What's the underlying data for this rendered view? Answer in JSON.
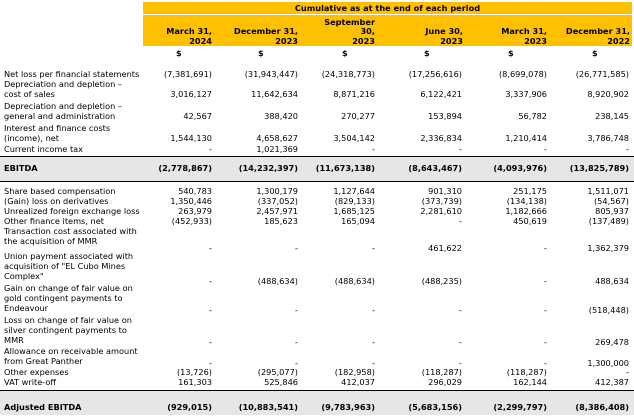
{
  "header": {
    "title": "Cumulative as at the end of each period"
  },
  "columns": [
    {
      "label": "March 31,\n2024",
      "currency": "$"
    },
    {
      "label": "December 31,\n2023",
      "currency": "$"
    },
    {
      "label": "September\n30,\n2023",
      "currency": "$"
    },
    {
      "label": "June 30,\n2023",
      "currency": "$"
    },
    {
      "label": "March 31,\n2023",
      "currency": "$"
    },
    {
      "label": "December 31,\n2022",
      "currency": "$"
    }
  ],
  "section1": [
    {
      "label": "Net loss per financial statements",
      "values": [
        "(7,381,691)",
        "(31,943,447)",
        "(24,318,773)",
        "(17,256,616)",
        "(8,699,078)",
        "(26,771,585)"
      ]
    },
    {
      "label": "Depreciation and depletion –\ncost of sales",
      "values": [
        "3,016,127",
        "11,642,634",
        "8,871,216",
        "6,122,421",
        "3,337,906",
        "8,920,902"
      ]
    },
    {
      "label": "Depreciation and depletion –\ngeneral and administration",
      "values": [
        "42,567",
        "388,420",
        "270,277",
        "153,894",
        "56,782",
        "238,145"
      ]
    },
    {
      "label": "Interest and finance costs\n(income), net",
      "values": [
        "1,544,130",
        "4,658,627",
        "3,504,142",
        "2,336,834",
        "1,210,414",
        "3,786,748"
      ]
    },
    {
      "label": "Current income tax",
      "values": [
        "-",
        "1,021,369",
        "-",
        "-",
        "-",
        "-"
      ]
    }
  ],
  "ebitda": {
    "label": "EBITDA",
    "values": [
      "(2,778,867)",
      "(14,232,397)",
      "(11,673,138)",
      "(8,643,467)",
      "(4,093,976)",
      "(13,825,789)"
    ]
  },
  "section2": [
    {
      "label": "Share based compensation",
      "values": [
        "540,783",
        "1,300,179",
        "1,127,644",
        "901,310",
        "251,175",
        "1,511,071"
      ]
    },
    {
      "label": "(Gain) loss on derivatives",
      "values": [
        "1,350,446",
        "(337,052)",
        "(829,133)",
        "(373,739)",
        "(134,138)",
        "(54,567)"
      ]
    },
    {
      "label": "Unrealized foreign exchange loss",
      "values": [
        "263,979",
        "2,457,971",
        "1,685,125",
        "2,281,610",
        "1,182,666",
        "805,937"
      ]
    },
    {
      "label": "Other finance items, net",
      "values": [
        "(452,933)",
        "185,623",
        "165,094",
        "-",
        "450,619",
        "(137,489)"
      ]
    },
    {
      "label": "Transaction cost associated with\nthe acquisition of MMR",
      "values": [
        "-",
        "-",
        "-",
        "461,622",
        "-",
        "1,362,379"
      ]
    },
    {
      "label": "Union payment associated with\nacquisition of \"EL Cubo Mines\nComplex\"",
      "values": [
        "-",
        "(488,634)",
        "(488,634)",
        "(488,235)",
        "-",
        "488,634"
      ]
    },
    {
      "label": "Gain on change of fair value on\ngold contingent payments to\nEndeavour",
      "values": [
        "-",
        "-",
        "-",
        "-",
        "-",
        "(518,448)"
      ]
    },
    {
      "label": "Loss on change of fair value on\nsilver contingent payments to\nMMR",
      "values": [
        "-",
        "-",
        "-",
        "-",
        "-",
        "269,478"
      ]
    },
    {
      "label": "Allowance on receivable amount\nfrom Great Panther",
      "values": [
        "-",
        "-",
        "-",
        "-",
        "-",
        "1,300,000"
      ]
    },
    {
      "label": "Other expenses",
      "values": [
        "(13,726)",
        "(295,077)",
        "(182,958)",
        "(118,287)",
        "(118,287)",
        "-"
      ]
    },
    {
      "label": "VAT write-off",
      "values": [
        "161,303",
        "525,846",
        "412,037",
        "296,029",
        "162,144",
        "412,387"
      ]
    }
  ],
  "adjusted": {
    "label": "Adjusted EBITDA",
    "values": [
      "(929,015)",
      "(10,883,541)",
      "(9,783,963)",
      "(5,683,156)",
      "(2,299,797)",
      "(8,386,408)"
    ]
  }
}
